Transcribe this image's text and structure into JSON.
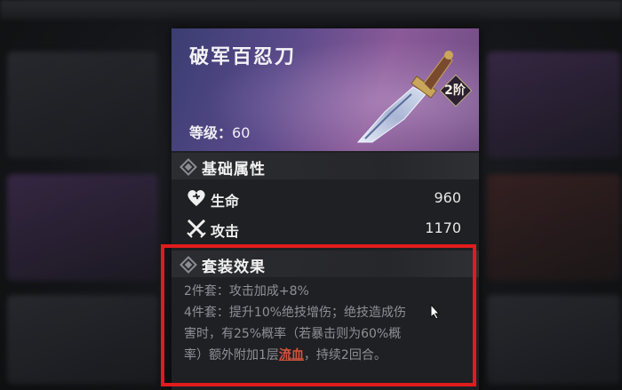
{
  "item": {
    "name": "破军百忍刀",
    "rank": "2阶",
    "level_label": "等级：",
    "level_value": "60"
  },
  "base_attributes": {
    "title": "基础属性",
    "stats": [
      {
        "name": "生命",
        "value": "960",
        "icon": "heart-icon"
      },
      {
        "name": "攻击",
        "value": "1170",
        "icon": "crossed-swords-icon"
      }
    ]
  },
  "set_effect": {
    "title": "套装效果",
    "two_piece_prefix": "2件套：",
    "two_piece_text": "攻击加成+8%",
    "four_piece_prefix": "4件套：",
    "four_piece_line1": "提升10%绝技增伤；绝技造成伤",
    "four_piece_line2": "害时，有25%概率（若暴击则为60%概",
    "four_piece_line3_a": "率）额外附加1层",
    "four_piece_highlight": "流血",
    "four_piece_line3_b": "，持续2回合。"
  },
  "colors": {
    "highlight": "#d4553c",
    "annotation_box": "#e01c1c"
  }
}
